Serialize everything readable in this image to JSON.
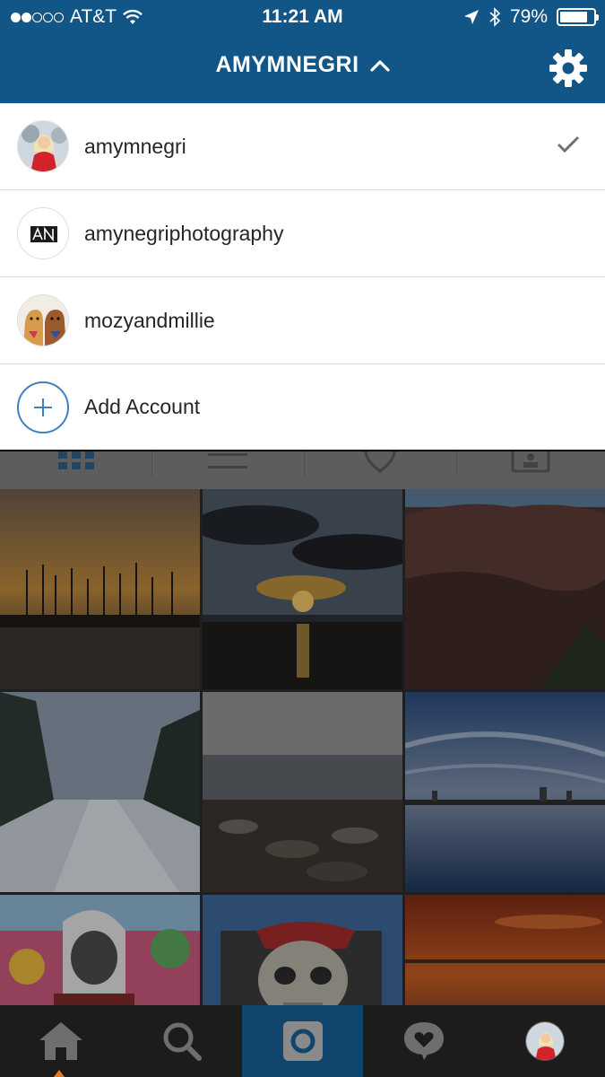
{
  "status_bar": {
    "carrier": "AT&T",
    "time": "11:21 AM",
    "battery": "79%",
    "battery_level": 0.79,
    "signal_bars_filled": 2,
    "signal_bars_total": 5
  },
  "header": {
    "title": "AMYMNEGRI",
    "color": "#125688"
  },
  "accounts": [
    {
      "name": "amymnegri",
      "selected": true,
      "avatar_icon": "profile-photo"
    },
    {
      "name": "amynegriphotography",
      "selected": false,
      "avatar_icon": "an-logo"
    },
    {
      "name": "mozyandmillie",
      "selected": false,
      "avatar_icon": "dogs-photo"
    }
  ],
  "add_account": {
    "label": "Add Account",
    "accent": "#3f80c0"
  },
  "profile_tabs": [
    "grid-view-icon",
    "list-view-icon",
    "location-pin-icon",
    "tagged-photos-icon"
  ],
  "photos": [
    "harbor-sunset",
    "lake-sunset-clouds",
    "red-rock-canyon",
    "snowy-forest-road",
    "rocky-shore",
    "city-skyline-reflection",
    "clown-figure",
    "pirate-skull",
    "orange-sunset-sea"
  ],
  "bottom_tabs": [
    "home-icon",
    "search-icon",
    "camera-icon",
    "activity-icon",
    "profile-avatar"
  ]
}
